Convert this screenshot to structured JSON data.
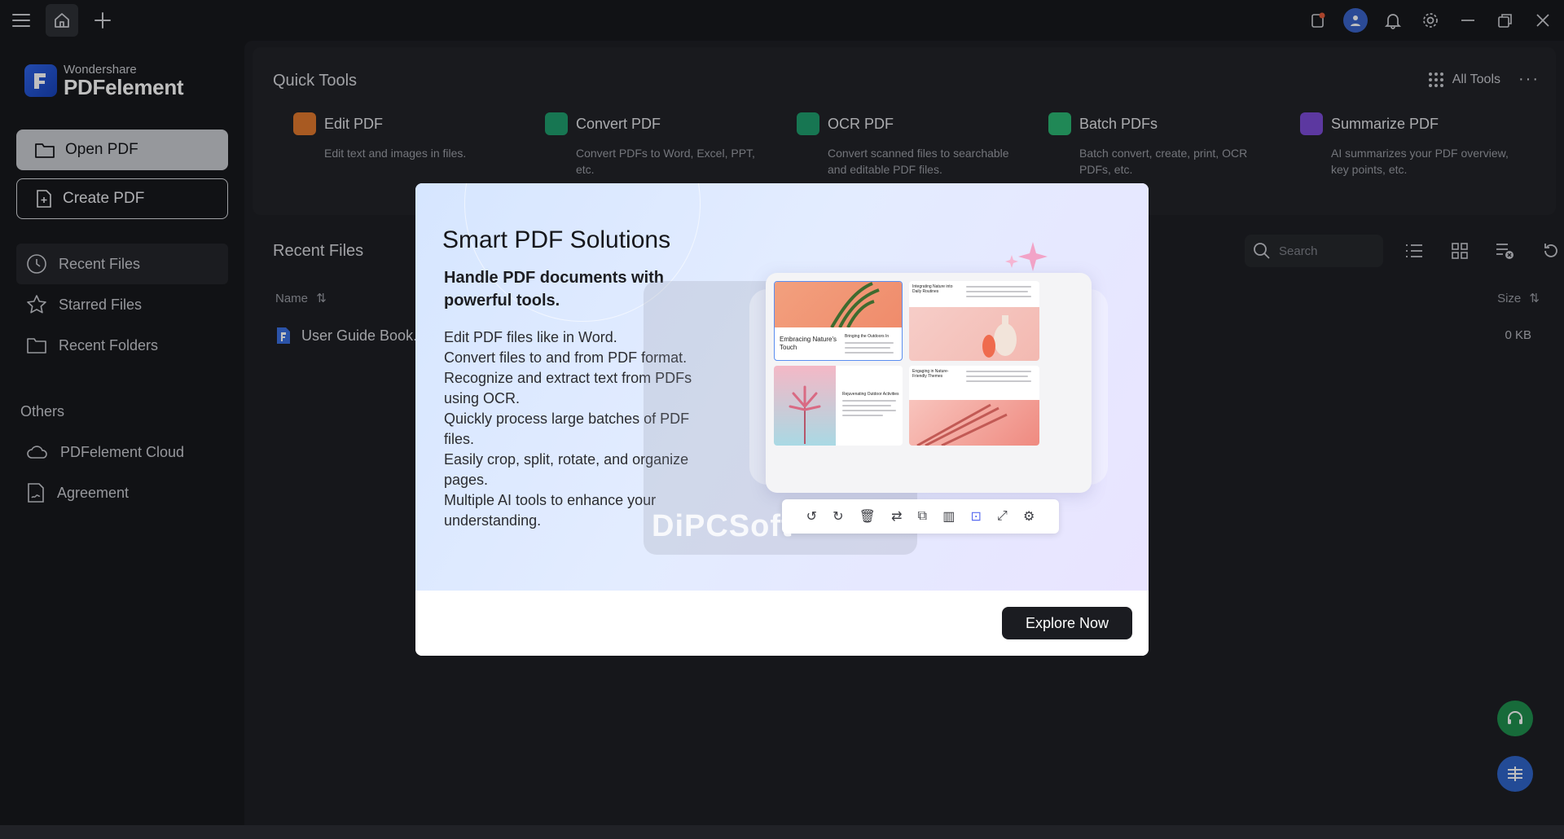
{
  "brand": {
    "sub": "Wondershare",
    "name": "PDFelement"
  },
  "sidebar": {
    "open_label": "Open PDF",
    "create_label": "Create PDF",
    "nav": [
      {
        "label": "Recent Files"
      },
      {
        "label": "Starred Files"
      },
      {
        "label": "Recent Folders"
      }
    ],
    "others_title": "Others",
    "others": [
      {
        "label": "PDFelement Cloud"
      },
      {
        "label": "Agreement"
      }
    ]
  },
  "quick_tools": {
    "title": "Quick Tools",
    "all_tools": "All Tools",
    "more": "···",
    "tools": [
      {
        "name": "Edit PDF",
        "desc": "Edit text and images in files.",
        "color": "#e0792e"
      },
      {
        "name": "Convert PDF",
        "desc": "Convert PDFs to Word, Excel, PPT, etc.",
        "color": "#1f9e6e"
      },
      {
        "name": "OCR PDF",
        "desc": "Convert scanned files to searchable and editable PDF files.",
        "color": "#1f9e6e"
      },
      {
        "name": "Batch PDFs",
        "desc": "Batch convert, create, print, OCR PDFs, etc.",
        "color": "#2bb673"
      },
      {
        "name": "Summarize PDF",
        "desc": "AI summarizes your PDF overview, key points, etc.",
        "color": "#7b4bd6"
      }
    ]
  },
  "recent": {
    "title": "Recent Files",
    "search_placeholder": "Search",
    "col_name": "Name",
    "col_size": "Size",
    "sort_icon": "⇅",
    "files": [
      {
        "name": "User Guide Book.",
        "size": "0 KB"
      }
    ]
  },
  "modal": {
    "title": "Smart PDF Solutions",
    "subtitle": "Handle PDF documents with powerful tools.",
    "lines": [
      "Edit PDF files like in Word.",
      "Convert files to and from PDF format.",
      "Recognize and extract text from PDFs using OCR.",
      "Quickly process large batches of PDF files.",
      "Easily crop, split, rotate, and organize pages.",
      "Multiple AI tools to enhance your understanding."
    ],
    "illustration": {
      "card1_title": "Embracing Nature's Touch",
      "card1_sub": "Bringing the Outdoors In",
      "card2_title": "Integrating Nature into Daily Routines",
      "card3_title": "Rejuvenating Outdoor Activities",
      "card4_title": "Engaging in Nature-Friendly Themes"
    },
    "watermark": "DiPCSoft",
    "cta": "Explore Now"
  },
  "colors": {
    "accent": "#2f64e8",
    "support_green": "#1f8f4e",
    "fab_blue": "#2f64c8"
  }
}
